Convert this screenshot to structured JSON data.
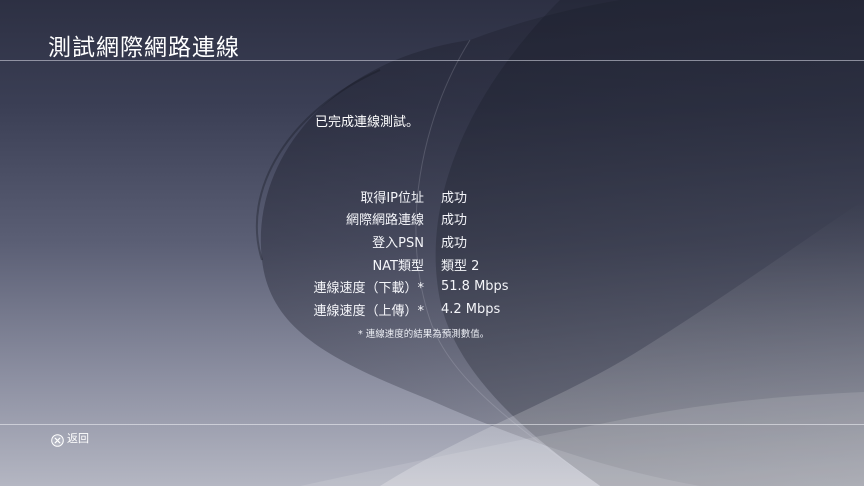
{
  "header": {
    "title": "測試網際網路連線"
  },
  "main": {
    "message": "已完成連線測試。",
    "results": [
      {
        "label": "取得IP位址",
        "value": "成功"
      },
      {
        "label": "網際網路連線",
        "value": "成功"
      },
      {
        "label": "登入PSN",
        "value": "成功"
      },
      {
        "label": "NAT類型",
        "value": "類型 2"
      },
      {
        "label": "連線速度（下載）*",
        "value": "51.8 Mbps"
      },
      {
        "label": "連線速度（上傳）*",
        "value": "4.2 Mbps"
      }
    ],
    "footnote": "* 連線速度的結果為預測數值。"
  },
  "footer": {
    "back_icon": "cross-button-icon",
    "back_label": "返回"
  },
  "colors": {
    "background_top": "#2d3043",
    "background_bottom": "#b4b6c2",
    "text": "#ffffff"
  }
}
